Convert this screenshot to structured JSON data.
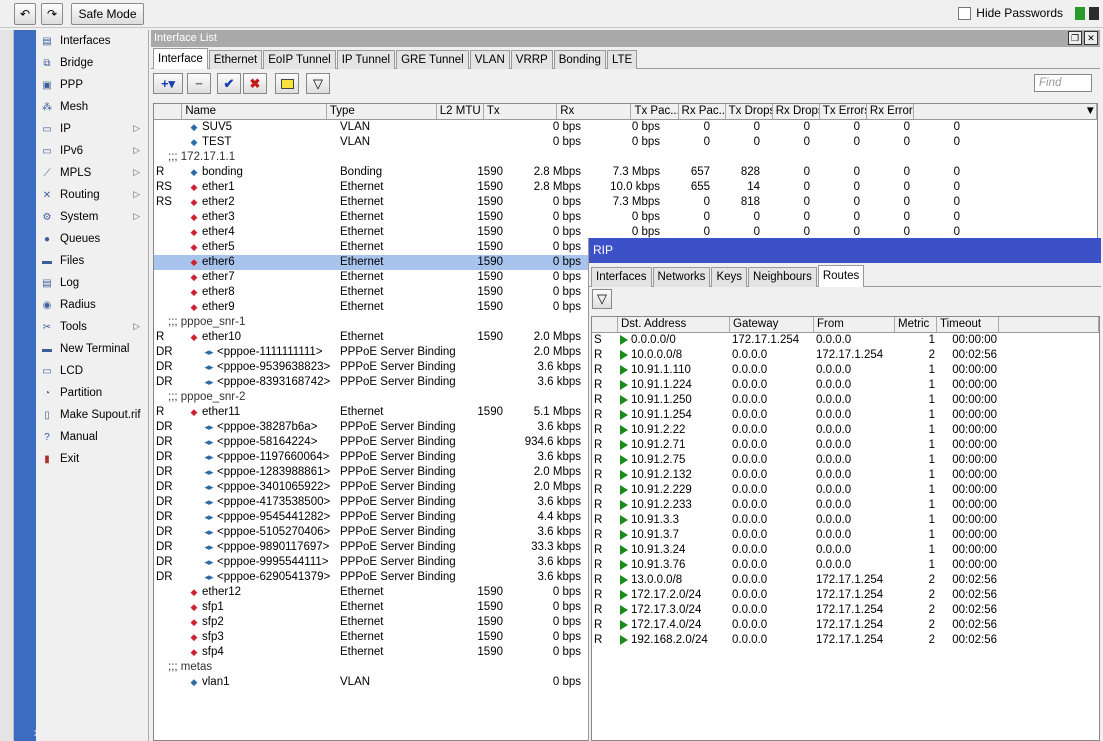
{
  "toolbar": {
    "undo_icon": "undo-icon",
    "redo_icon": "redo-icon",
    "safe_mode": "Safe Mode",
    "hide_passwords": "Hide Passwords"
  },
  "strip": {
    "close": "x"
  },
  "menu": [
    {
      "label": "Interfaces",
      "icon": "interfaces-icon"
    },
    {
      "label": "Bridge",
      "icon": "bridge-icon"
    },
    {
      "label": "PPP",
      "icon": "ppp-icon"
    },
    {
      "label": "Mesh",
      "icon": "mesh-icon"
    },
    {
      "label": "IP",
      "icon": "ip-icon",
      "arrow": true
    },
    {
      "label": "IPv6",
      "icon": "ipv6-icon",
      "arrow": true
    },
    {
      "label": "MPLS",
      "icon": "mpls-icon",
      "arrow": true
    },
    {
      "label": "Routing",
      "icon": "routing-icon",
      "arrow": true
    },
    {
      "label": "System",
      "icon": "system-icon",
      "arrow": true
    },
    {
      "label": "Queues",
      "icon": "queues-icon"
    },
    {
      "label": "Files",
      "icon": "files-icon"
    },
    {
      "label": "Log",
      "icon": "log-icon"
    },
    {
      "label": "Radius",
      "icon": "radius-icon"
    },
    {
      "label": "Tools",
      "icon": "tools-icon",
      "arrow": true
    },
    {
      "label": "New Terminal",
      "icon": "terminal-icon"
    },
    {
      "label": "LCD",
      "icon": "lcd-icon"
    },
    {
      "label": "Partition",
      "icon": "partition-icon"
    },
    {
      "label": "Make Supout.rif",
      "icon": "supout-icon"
    },
    {
      "label": "Manual",
      "icon": "manual-icon"
    },
    {
      "label": "Exit",
      "icon": "exit-icon"
    }
  ],
  "iface": {
    "title": "Interface List",
    "tabs": [
      "Interface",
      "Ethernet",
      "EoIP Tunnel",
      "IP Tunnel",
      "GRE Tunnel",
      "VLAN",
      "VRRP",
      "Bonding",
      "LTE"
    ],
    "find_placeholder": "Find",
    "columns": [
      "",
      "Name",
      "Type",
      "L2 MTU",
      "Tx",
      "Rx",
      "Tx Pac...",
      "Rx Pac...",
      "Tx Drops",
      "Rx Drops",
      "Tx Errors",
      "Rx Errors"
    ],
    "rows": [
      {
        "f": "",
        "n": "SUV5",
        "t": "VLAN",
        "m": "",
        "tx": "0 bps",
        "rx": "0 bps",
        "tp": "0",
        "rp": "0",
        "td": "0",
        "rd": "0",
        "te": "0",
        "re": "0",
        "ind": 0
      },
      {
        "f": "",
        "n": "TEST",
        "t": "VLAN",
        "m": "",
        "tx": "0 bps",
        "rx": "0 bps",
        "tp": "0",
        "rp": "0",
        "td": "0",
        "rd": "0",
        "te": "0",
        "re": "0",
        "ind": 0
      },
      {
        "comment": ";;; 172.17.1.1"
      },
      {
        "f": "R",
        "n": "bonding",
        "t": "Bonding",
        "m": "1590",
        "tx": "2.8 Mbps",
        "rx": "7.3 Mbps",
        "tp": "657",
        "rp": "828",
        "td": "0",
        "rd": "0",
        "te": "0",
        "re": "0",
        "ind": 0
      },
      {
        "f": "RS",
        "n": "ether1",
        "t": "Ethernet",
        "m": "1590",
        "tx": "2.8 Mbps",
        "rx": "10.0 kbps",
        "tp": "655",
        "rp": "14",
        "td": "0",
        "rd": "0",
        "te": "0",
        "re": "0",
        "ind": 0,
        "eth": true
      },
      {
        "f": "RS",
        "n": "ether2",
        "t": "Ethernet",
        "m": "1590",
        "tx": "0 bps",
        "rx": "7.3 Mbps",
        "tp": "0",
        "rp": "818",
        "td": "0",
        "rd": "0",
        "te": "0",
        "re": "0",
        "ind": 0,
        "eth": true
      },
      {
        "f": "",
        "n": "ether3",
        "t": "Ethernet",
        "m": "1590",
        "tx": "0 bps",
        "rx": "0 bps",
        "tp": "0",
        "rp": "0",
        "td": "0",
        "rd": "0",
        "te": "0",
        "re": "0",
        "ind": 0,
        "eth": true
      },
      {
        "f": "",
        "n": "ether4",
        "t": "Ethernet",
        "m": "1590",
        "tx": "0 bps",
        "rx": "0 bps",
        "tp": "0",
        "rp": "0",
        "td": "0",
        "rd": "0",
        "te": "0",
        "re": "0",
        "ind": 0,
        "eth": true
      },
      {
        "f": "",
        "n": "ether5",
        "t": "Ethernet",
        "m": "1590",
        "tx": "0 bps",
        "ind": 0,
        "eth": true
      },
      {
        "f": "",
        "n": "ether6",
        "t": "Ethernet",
        "m": "1590",
        "tx": "0 bps",
        "ind": 0,
        "eth": true,
        "sel": true
      },
      {
        "f": "",
        "n": "ether7",
        "t": "Ethernet",
        "m": "1590",
        "tx": "0 bps",
        "ind": 0,
        "eth": true
      },
      {
        "f": "",
        "n": "ether8",
        "t": "Ethernet",
        "m": "1590",
        "tx": "0 bps",
        "ind": 0,
        "eth": true
      },
      {
        "f": "",
        "n": "ether9",
        "t": "Ethernet",
        "m": "1590",
        "tx": "0 bps",
        "ind": 0,
        "eth": true
      },
      {
        "comment": ";;; pppoe_snr-1"
      },
      {
        "f": "R",
        "n": "ether10",
        "t": "Ethernet",
        "m": "1590",
        "tx": "2.0 Mbps",
        "ind": 0,
        "eth": true
      },
      {
        "f": "DR",
        "n": "<pppoe-1111111111>",
        "t": "PPPoE Server Binding",
        "m": "",
        "tx": "2.0 Mbps",
        "ind": 1
      },
      {
        "f": "DR",
        "n": "<pppoe-9539638823>",
        "t": "PPPoE Server Binding",
        "m": "",
        "tx": "3.6 kbps",
        "ind": 1
      },
      {
        "f": "DR",
        "n": "<pppoe-8393168742>",
        "t": "PPPoE Server Binding",
        "m": "",
        "tx": "3.6 kbps",
        "ind": 1
      },
      {
        "comment": ";;; pppoe_snr-2"
      },
      {
        "f": "R",
        "n": "ether11",
        "t": "Ethernet",
        "m": "1590",
        "tx": "5.1 Mbps",
        "ind": 0,
        "eth": true
      },
      {
        "f": "DR",
        "n": "<pppoe-38287b6a>",
        "t": "PPPoE Server Binding",
        "m": "",
        "tx": "3.6 kbps",
        "ind": 1
      },
      {
        "f": "DR",
        "n": "<pppoe-58164224>",
        "t": "PPPoE Server Binding",
        "m": "",
        "tx": "934.6 kbps",
        "ind": 1
      },
      {
        "f": "DR",
        "n": "<pppoe-1197660064>",
        "t": "PPPoE Server Binding",
        "m": "",
        "tx": "3.6 kbps",
        "ind": 1
      },
      {
        "f": "DR",
        "n": "<pppoe-1283988861>",
        "t": "PPPoE Server Binding",
        "m": "",
        "tx": "2.0 Mbps",
        "ind": 1
      },
      {
        "f": "DR",
        "n": "<pppoe-3401065922>",
        "t": "PPPoE Server Binding",
        "m": "",
        "tx": "2.0 Mbps",
        "ind": 1
      },
      {
        "f": "DR",
        "n": "<pppoe-4173538500>",
        "t": "PPPoE Server Binding",
        "m": "",
        "tx": "3.6 kbps",
        "ind": 1
      },
      {
        "f": "DR",
        "n": "<pppoe-9545441282>",
        "t": "PPPoE Server Binding",
        "m": "",
        "tx": "4.4 kbps",
        "ind": 1
      },
      {
        "f": "DR",
        "n": "<pppoe-5105270406>",
        "t": "PPPoE Server Binding",
        "m": "",
        "tx": "3.6 kbps",
        "ind": 1
      },
      {
        "f": "DR",
        "n": "<pppoe-9890117697>",
        "t": "PPPoE Server Binding",
        "m": "",
        "tx": "33.3 kbps",
        "ind": 1
      },
      {
        "f": "DR",
        "n": "<pppoe-9995544111>",
        "t": "PPPoE Server Binding",
        "m": "",
        "tx": "3.6 kbps",
        "ind": 1
      },
      {
        "f": "DR",
        "n": "<pppoe-6290541379>",
        "t": "PPPoE Server Binding",
        "m": "",
        "tx": "3.6 kbps",
        "ind": 1
      },
      {
        "f": "",
        "n": "ether12",
        "t": "Ethernet",
        "m": "1590",
        "tx": "0 bps",
        "ind": 0,
        "eth": true
      },
      {
        "f": "",
        "n": "sfp1",
        "t": "Ethernet",
        "m": "1590",
        "tx": "0 bps",
        "ind": 0,
        "eth": true
      },
      {
        "f": "",
        "n": "sfp2",
        "t": "Ethernet",
        "m": "1590",
        "tx": "0 bps",
        "ind": 0,
        "eth": true
      },
      {
        "f": "",
        "n": "sfp3",
        "t": "Ethernet",
        "m": "1590",
        "tx": "0 bps",
        "ind": 0,
        "eth": true
      },
      {
        "f": "",
        "n": "sfp4",
        "t": "Ethernet",
        "m": "1590",
        "tx": "0 bps",
        "ind": 0,
        "eth": true
      },
      {
        "comment": ";;; metas"
      },
      {
        "f": "",
        "n": "vlan1",
        "t": "VLAN",
        "m": "",
        "tx": "0 bps",
        "ind": 0
      }
    ]
  },
  "rip": {
    "title": "RIP",
    "tabs": [
      "Interfaces",
      "Networks",
      "Keys",
      "Neighbours",
      "Routes"
    ],
    "columns": [
      "",
      "Dst. Address",
      "Gateway",
      "From",
      "Metric",
      "Timeout"
    ],
    "rows": [
      [
        "S",
        "0.0.0.0/0",
        "172.17.1.254",
        "0.0.0.0",
        "1",
        "00:00:00"
      ],
      [
        "R",
        "10.0.0.0/8",
        "0.0.0.0",
        "172.17.1.254",
        "2",
        "00:02:56"
      ],
      [
        "R",
        "10.91.1.110",
        "0.0.0.0",
        "0.0.0.0",
        "1",
        "00:00:00"
      ],
      [
        "R",
        "10.91.1.224",
        "0.0.0.0",
        "0.0.0.0",
        "1",
        "00:00:00"
      ],
      [
        "R",
        "10.91.1.250",
        "0.0.0.0",
        "0.0.0.0",
        "1",
        "00:00:00"
      ],
      [
        "R",
        "10.91.1.254",
        "0.0.0.0",
        "0.0.0.0",
        "1",
        "00:00:00"
      ],
      [
        "R",
        "10.91.2.22",
        "0.0.0.0",
        "0.0.0.0",
        "1",
        "00:00:00"
      ],
      [
        "R",
        "10.91.2.71",
        "0.0.0.0",
        "0.0.0.0",
        "1",
        "00:00:00"
      ],
      [
        "R",
        "10.91.2.75",
        "0.0.0.0",
        "0.0.0.0",
        "1",
        "00:00:00"
      ],
      [
        "R",
        "10.91.2.132",
        "0.0.0.0",
        "0.0.0.0",
        "1",
        "00:00:00"
      ],
      [
        "R",
        "10.91.2.229",
        "0.0.0.0",
        "0.0.0.0",
        "1",
        "00:00:00"
      ],
      [
        "R",
        "10.91.2.233",
        "0.0.0.0",
        "0.0.0.0",
        "1",
        "00:00:00"
      ],
      [
        "R",
        "10.91.3.3",
        "0.0.0.0",
        "0.0.0.0",
        "1",
        "00:00:00"
      ],
      [
        "R",
        "10.91.3.7",
        "0.0.0.0",
        "0.0.0.0",
        "1",
        "00:00:00"
      ],
      [
        "R",
        "10.91.3.24",
        "0.0.0.0",
        "0.0.0.0",
        "1",
        "00:00:00"
      ],
      [
        "R",
        "10.91.3.76",
        "0.0.0.0",
        "0.0.0.0",
        "1",
        "00:00:00"
      ],
      [
        "R",
        "13.0.0.0/8",
        "0.0.0.0",
        "172.17.1.254",
        "2",
        "00:02:56"
      ],
      [
        "R",
        "172.17.2.0/24",
        "0.0.0.0",
        "172.17.1.254",
        "2",
        "00:02:56"
      ],
      [
        "R",
        "172.17.3.0/24",
        "0.0.0.0",
        "172.17.1.254",
        "2",
        "00:02:56"
      ],
      [
        "R",
        "172.17.4.0/24",
        "0.0.0.0",
        "172.17.1.254",
        "2",
        "00:02:56"
      ],
      [
        "R",
        "192.168.2.0/24",
        "0.0.0.0",
        "172.17.1.254",
        "2",
        "00:02:56"
      ]
    ]
  },
  "colors": {
    "accent": "#3c50c8",
    "sidebar_strip": "#3c6cc2",
    "selected_row": "#a8c4ec"
  }
}
